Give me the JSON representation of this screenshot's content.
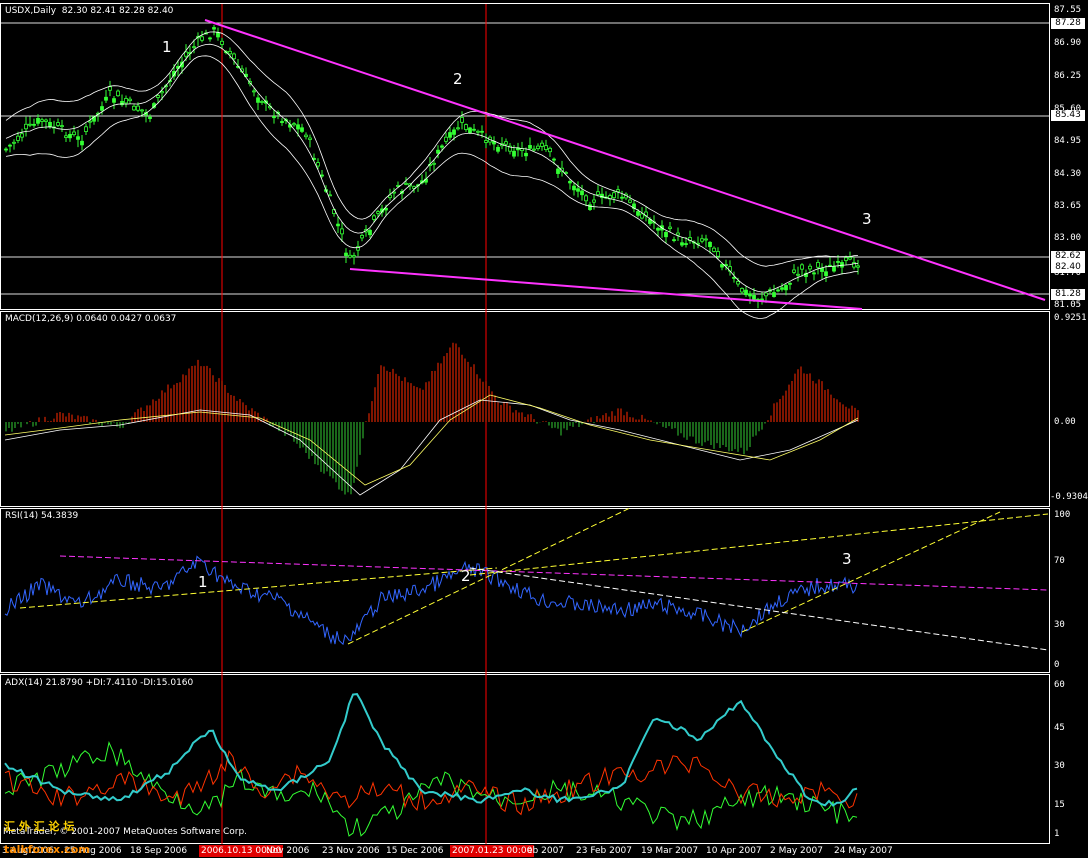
{
  "window": {
    "title": "USDX,Daily",
    "ohlc": "82.30 82.41 82.28 82.40",
    "copyright": "MetaTrader, © 2001-2007 MetaQuotes Software Corp.",
    "watermark_site": "talkforex.com",
    "watermark_cn": "汇 外 汇 论 坛"
  },
  "colors": {
    "background": "#000000",
    "grid": "#ffffff",
    "candles": "#33ff33",
    "bands": "#ffffff",
    "trendline": "#ff33ff",
    "macd_pos": "#ff2a00",
    "macd_neg": "#33cc33",
    "signal": "#ffff66",
    "rsi": "#3366ff",
    "adx": "#33cccc",
    "plus_di": "#33ff33",
    "minus_di": "#ff3300",
    "vline": "#ff0000",
    "time_tag": "#e00000"
  },
  "price_axis": {
    "labels": [
      "87.55",
      "86.90",
      "86.25",
      "85.60",
      "84.95",
      "84.30",
      "83.65",
      "83.00",
      "81.70",
      "81.05"
    ],
    "tags": [
      "87.28",
      "85.43",
      "82.62",
      "82.40",
      "81.28"
    ]
  },
  "time_axis": {
    "labels": [
      "3 Aug 2006",
      "25 Aug 2006",
      "18 Sep 2006",
      "Nov 2006",
      "23 Nov 2006",
      "15 Dec 2006",
      "eb 2007",
      "23 Feb 2007",
      "19 Mar 2007",
      "10 Apr 2007",
      "2 May 2007",
      "24 May 2007"
    ],
    "highlight_tags": [
      "2006.10.13 00:00",
      "2007.01.23 00:00"
    ]
  },
  "macd": {
    "title": "MACD(12,26,9) 0.0640 0.0427 0.0637",
    "axis": [
      "0.9251",
      "0.00",
      "-0.9304"
    ]
  },
  "rsi": {
    "title": "RSI(14) 54.3839",
    "axis": [
      "100",
      "70",
      "30",
      "0"
    ]
  },
  "adx": {
    "title": "ADX(14) 21.8790 +DI:7.4110 -DI:15.0160",
    "axis": [
      "60",
      "45",
      "30",
      "15",
      "1"
    ]
  },
  "markers": {
    "price": [
      "1",
      "2",
      "3"
    ],
    "rsi": [
      "1",
      "2",
      "3"
    ]
  }
}
